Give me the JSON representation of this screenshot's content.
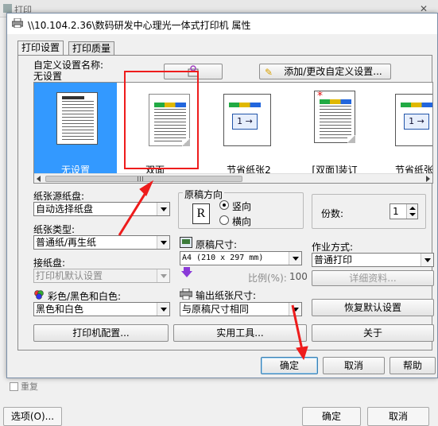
{
  "background": {
    "title": "打印",
    "buttons": {
      "options": "选项(O)...",
      "ok": "确定",
      "cancel": "取消"
    },
    "checkbox_label": "重复"
  },
  "dialog": {
    "title": "\\\\10.104.2.36\\数码研发中心理光一体式打印机 属性",
    "tabs": [
      "打印设置",
      "打印质量"
    ],
    "custom_settings": {
      "label": "自定义设置名称:",
      "value": "无设置",
      "add_button": "添加/更改自定义设置..."
    },
    "presets": [
      {
        "label": "无设置",
        "selected": true
      },
      {
        "label": "双面",
        "selected": false
      },
      {
        "label": "节省纸张2",
        "selected": false
      },
      {
        "label": "[双面]装订",
        "selected": false
      },
      {
        "label": "节省纸张",
        "selected": false
      }
    ],
    "paper_source": {
      "label": "纸张源纸盘:",
      "value": "自动选择纸盘"
    },
    "paper_type": {
      "label": "纸张类型:",
      "value": "普通纸/再生纸"
    },
    "output_tray": {
      "label": "接纸盘:",
      "value": "打印机默认设置"
    },
    "color_mode": {
      "label": "彩色/黑色和白色:",
      "value": "黑色和白色"
    },
    "orientation": {
      "label": "原稿方向",
      "portrait": "竖向",
      "landscape": "横向",
      "selected": "portrait"
    },
    "original_size": {
      "label": "原稿尺寸:",
      "value": "A4 (210 x 297 mm)"
    },
    "scale": {
      "label": "比例(%):",
      "value": "100"
    },
    "output_size": {
      "label": "输出纸张尺寸:",
      "value": "与原稿尺寸相同"
    },
    "copies": {
      "label": "份数:",
      "value": "1"
    },
    "job_type": {
      "label": "作业方式:",
      "value": "普通打印",
      "details_button": "详细资料..."
    },
    "buttons": {
      "restore": "恢复默认设置",
      "printer_config": "打印机配置...",
      "utilities": "实用工具...",
      "about": "关于",
      "ok": "确定",
      "cancel": "取消",
      "help": "帮助"
    }
  }
}
